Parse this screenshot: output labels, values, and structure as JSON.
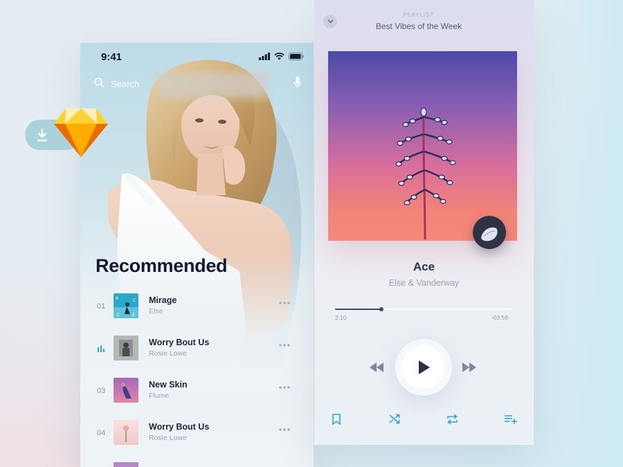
{
  "left_screen": {
    "status": {
      "time": "9:41"
    },
    "search": {
      "placeholder": "Search"
    },
    "section_title": "Recommended",
    "tracks": [
      {
        "number": "01",
        "title": "Mirage",
        "artist": "Else",
        "playing": false
      },
      {
        "number": "",
        "title": "Worry Bout Us",
        "artist": "Rosie Lowe",
        "playing": true
      },
      {
        "number": "03",
        "title": "New Skin",
        "artist": "Flume",
        "playing": false
      },
      {
        "number": "04",
        "title": "Worry Bout Us",
        "artist": "Rosie Lowe",
        "playing": false
      }
    ]
  },
  "right_screen": {
    "playlist_label": "PLAYLIST",
    "playlist_name": "Best Vibes of the Week",
    "song": {
      "title": "Ace",
      "artist": "Else & Vanderway"
    },
    "progress": {
      "elapsed": "2:10",
      "remaining": "-03:56",
      "fraction": 0.26
    },
    "controls": [
      "bookmark-icon",
      "shuffle-icon",
      "repeat-icon",
      "add-to-queue-icon"
    ]
  },
  "colors": {
    "accent": "#2aa8c9",
    "title_text": "#141a33",
    "muted_text": "#9aa3b3"
  }
}
